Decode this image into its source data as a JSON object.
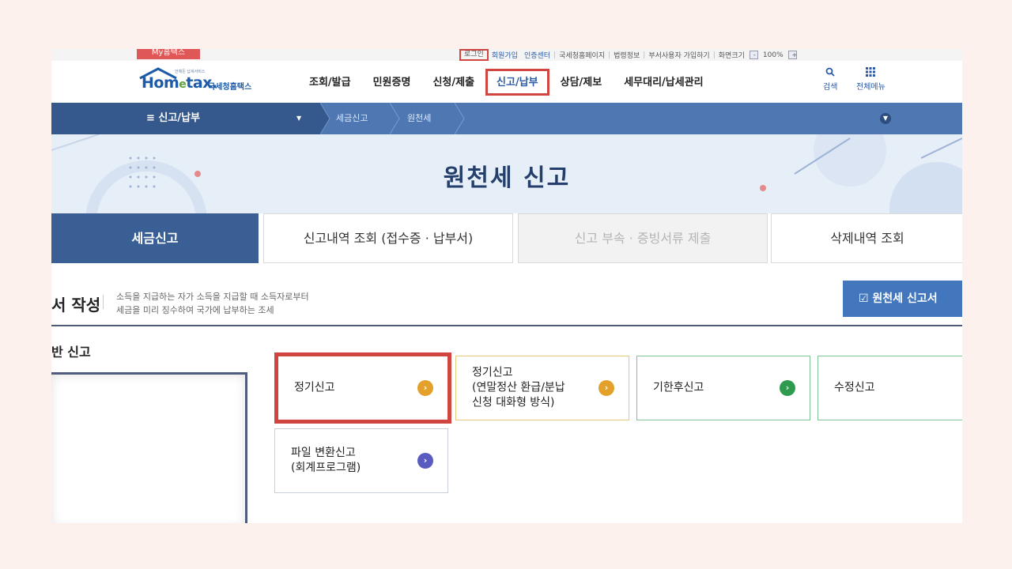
{
  "util": {
    "my_badge": "My홈택스",
    "login": "로그인",
    "signup": "회원가입",
    "cert_center": "인증센터",
    "nts_home": "국세청홈페이지",
    "law_info": "법령정보",
    "sub_user": "부서사용자 가입하기",
    "screen_size": "화면크기",
    "zoom_minus": "-",
    "zoom_value": "100%",
    "zoom_plus": "+"
  },
  "header": {
    "logo_main_1": "Hom",
    "logo_main_e": "e",
    "logo_main_2": "tax.",
    "logo_sub": "국세청홈택스",
    "logo_tiny": "언제든 납세서비스",
    "nav": [
      "조회/발급",
      "민원증명",
      "신청/제출",
      "신고/납부",
      "상담/제보",
      "세무대리/납세관리"
    ],
    "active_nav_index": 3,
    "search_label": "검색",
    "all_menu_label": "전체메뉴",
    "search_icon": "search-icon",
    "all_menu_icon": "grid-menu-icon"
  },
  "location": {
    "menu_label": "≡  신고/납부",
    "caret": "▼",
    "crumbs": [
      "세금신고",
      "원천세"
    ],
    "right_icon": "chevron-down-circle-icon"
  },
  "page": {
    "title": "원천세 신고"
  },
  "tabs": [
    {
      "label": "세금신고",
      "state": "active"
    },
    {
      "label": "신고내역 조회 (접수증 · 납부서)",
      "state": "normal"
    },
    {
      "label": "신고 부속 · 증빙서류 제출",
      "state": "disabled"
    },
    {
      "label": "삭제내역 조회",
      "state": "normal"
    }
  ],
  "section": {
    "title": "서 작성",
    "desc_line1": "소득을 지급하는 자가 소득을 지급할 때 소득자로부터",
    "desc_line2": "세금을 미리 징수하여 국가에 납부하는 조세",
    "button_label": "☑ 원천세 신고서 ",
    "sub_title": "반 신고"
  },
  "cards": [
    {
      "label": "정기신고",
      "arrow_color": "#e3a12b",
      "style": "highlight"
    },
    {
      "label": "정기신고\n(연말정산 환급/분납\n신청 대화형 방식)",
      "arrow_color": "#e3a12b",
      "style": "yellow"
    },
    {
      "label": "기한후신고",
      "arrow_color": "#2e9b4f",
      "style": "green"
    },
    {
      "label": "수정신고",
      "arrow_color": "#e3a12b",
      "style": "green"
    },
    {
      "label": "파일 변환신고\n(회계프로그램)",
      "arrow_color": "#5a5bc0",
      "style": "normal"
    }
  ],
  "colors": {
    "nav_highlight": "#d0453f",
    "locbar": "#4f77b2",
    "tab_active": "#3a5f94",
    "primary_button": "#4276bd"
  }
}
